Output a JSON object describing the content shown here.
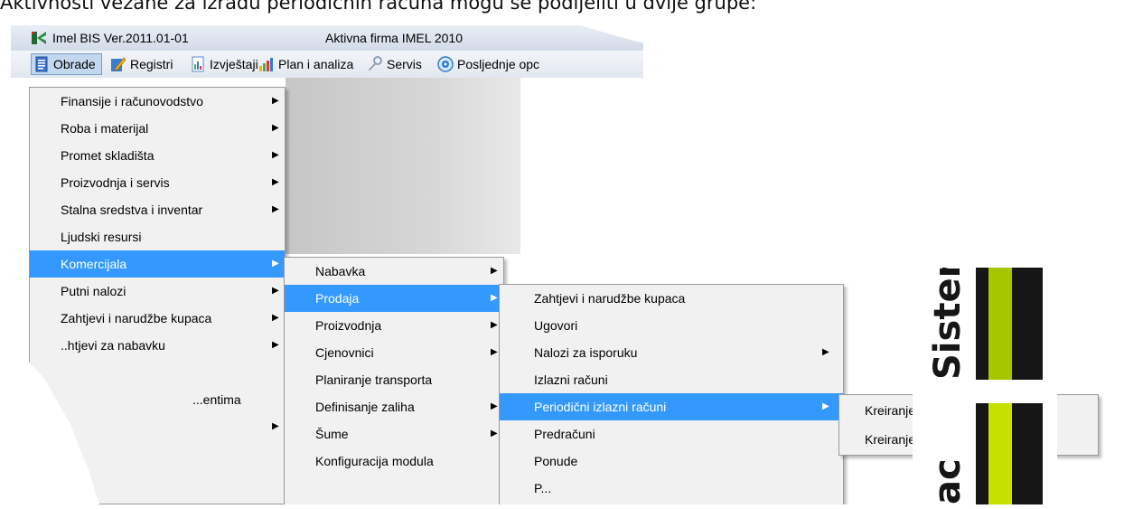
{
  "document": {
    "heading": "Aktivnosti vezane za izradu periodičnih računa mogu se podijeliti u dvije grupe:"
  },
  "window": {
    "title": "Imel BIS Ver.2011.01-01",
    "company": "Aktivna firma IMEL 2010"
  },
  "menubar": [
    {
      "label": "Obrade",
      "icon": "document-icon",
      "active": true
    },
    {
      "label": "Registri",
      "icon": "pencil-icon"
    },
    {
      "label": "Izvještaji",
      "icon": "report-icon"
    },
    {
      "label": "Plan i analiza",
      "icon": "bar-chart-icon"
    },
    {
      "label": "Servis",
      "icon": "wrench-icon"
    },
    {
      "label": "Posljednje opc",
      "icon": "disc-icon"
    }
  ],
  "menu_obrade": [
    {
      "label": "Finansije i računovodstvo",
      "submenu": true
    },
    {
      "label": "Roba i materijal",
      "submenu": true
    },
    {
      "label": "Promet skladišta",
      "submenu": true
    },
    {
      "label": "Proizvodnja i servis",
      "submenu": true
    },
    {
      "label": "Stalna sredstva i inventar",
      "submenu": true
    },
    {
      "label": "Ljudski resursi",
      "submenu": false
    },
    {
      "label": "Komercijala",
      "submenu": true,
      "highlighted": true
    },
    {
      "label": "Putni nalozi",
      "submenu": true
    },
    {
      "label": "Zahtjevi i narudžbe kupaca",
      "submenu": true
    },
    {
      "label": "..htjevi za nabavku",
      "submenu": true
    },
    {
      "label": "",
      "submenu": false
    },
    {
      "label": "...entima",
      "submenu": false
    },
    {
      "label": "",
      "submenu": true
    }
  ],
  "menu_komercijala": [
    {
      "label": "Nabavka",
      "submenu": true
    },
    {
      "label": "Prodaja",
      "submenu": true,
      "highlighted": true
    },
    {
      "label": "Proizvodnja",
      "submenu": true
    },
    {
      "label": "Cjenovnici",
      "submenu": true
    },
    {
      "label": "Planiranje transporta",
      "submenu": false
    },
    {
      "label": "Definisanje zaliha",
      "submenu": true
    },
    {
      "label": "Šume",
      "submenu": true
    },
    {
      "label": "Konfiguracija modula",
      "submenu": false
    }
  ],
  "menu_prodaja": [
    {
      "label": "Zahtjevi i narudžbe kupaca",
      "submenu": false
    },
    {
      "label": "Ugovori",
      "submenu": false
    },
    {
      "label": "Nalozi za isporuku",
      "submenu": true
    },
    {
      "label": "Izlazni računi",
      "submenu": false
    },
    {
      "label": "Periodični izlazni računi",
      "submenu": true,
      "highlighted": true
    },
    {
      "label": "Predračuni",
      "submenu": false
    },
    {
      "label": "Ponude",
      "submenu": false
    },
    {
      "label": "P...",
      "submenu": false
    }
  ],
  "menu_periodicni": [
    {
      "label": "Kreiranje periodičnih računa"
    },
    {
      "label": "Kreiranje izlaznih računa"
    }
  ],
  "logo": {
    "text_top": "Sistem",
    "text_bottom": "ac",
    "colors": {
      "black": "#161616",
      "green": "#a6c600",
      "bright_green": "#c6e000"
    }
  }
}
